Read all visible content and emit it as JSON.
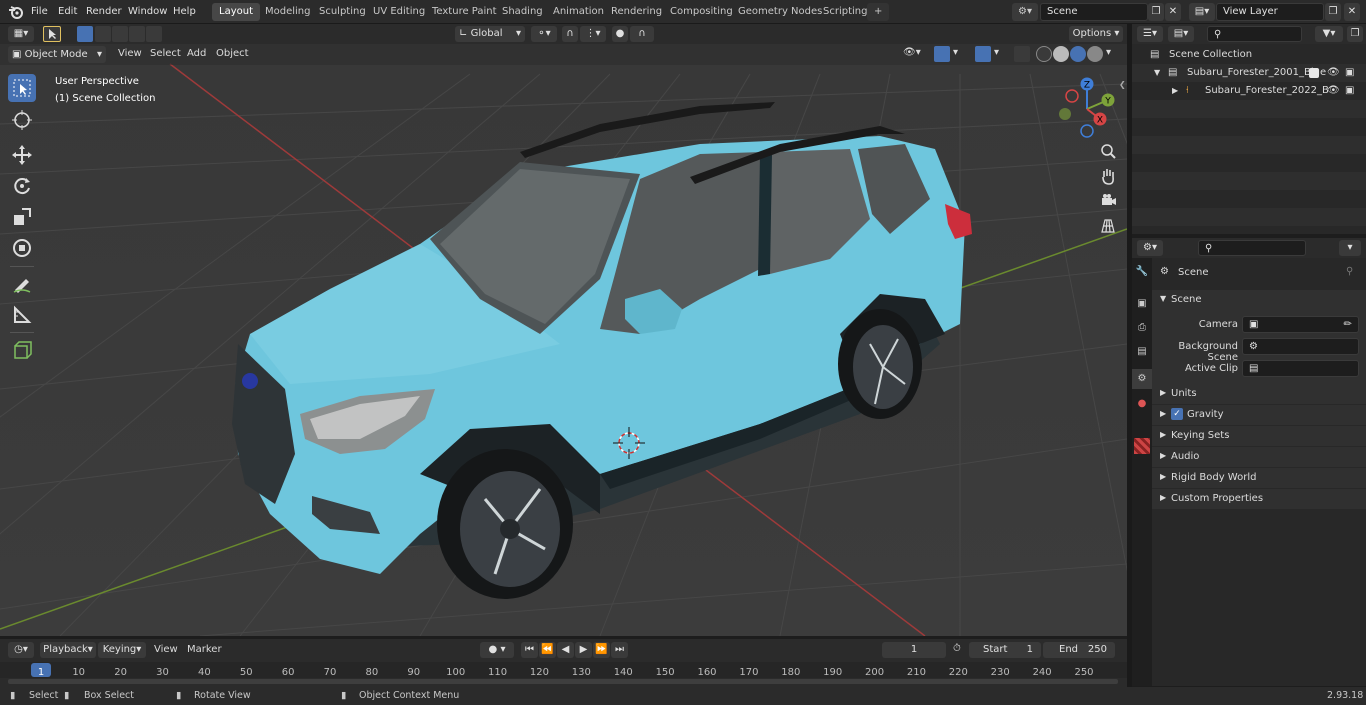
{
  "topbar": {
    "menus": [
      "File",
      "Edit",
      "Render",
      "Window",
      "Help"
    ],
    "workspaces": [
      "Layout",
      "Modeling",
      "Sculpting",
      "UV Editing",
      "Texture Paint",
      "Shading",
      "Animation",
      "Rendering",
      "Compositing",
      "Geometry Nodes",
      "Scripting"
    ],
    "active_workspace": "Layout",
    "add_tab": "+",
    "scene_name": "Scene",
    "view_layer": "View Layer"
  },
  "viewport_header": {
    "mode": "Object Mode",
    "menus": [
      "View",
      "Select",
      "Add",
      "Object"
    ],
    "transform_orientation": "Global",
    "options_label": "Options"
  },
  "viewport": {
    "overlay_line1": "User Perspective",
    "overlay_line2": "(1) Scene Collection",
    "axes": {
      "x": "X",
      "y": "Y",
      "z": "Z"
    }
  },
  "outliner": {
    "root": "Scene Collection",
    "items": [
      {
        "label": "Subaru_Forester_2001_Blue",
        "expanded": true
      },
      {
        "label": "Subaru_Forester_2022_B",
        "expanded": false
      }
    ]
  },
  "properties": {
    "context": "Scene",
    "section": "Scene",
    "fields": [
      {
        "label": "Camera",
        "value": ""
      },
      {
        "label": "Background Scene",
        "value": ""
      },
      {
        "label": "Active Clip",
        "value": ""
      }
    ],
    "panels": [
      "Units",
      "Gravity",
      "Keying Sets",
      "Audio",
      "Rigid Body World",
      "Custom Properties"
    ]
  },
  "timeline": {
    "menus": [
      "Playback",
      "Keying",
      "View",
      "Marker"
    ],
    "current_frame": "1",
    "start_label": "Start",
    "start_value": "1",
    "end_label": "End",
    "end_value": "250",
    "ticks": [
      "1",
      "10",
      "20",
      "30",
      "40",
      "50",
      "60",
      "70",
      "80",
      "90",
      "100",
      "110",
      "120",
      "130",
      "140",
      "150",
      "160",
      "170",
      "180",
      "190",
      "200",
      "210",
      "220",
      "230",
      "240",
      "250"
    ]
  },
  "statusbar": {
    "select": "Select",
    "box_select": "Box Select",
    "rotate_view": "Rotate View",
    "context_menu": "Object Context Menu",
    "version": "2.93.18"
  },
  "colors": {
    "accent": "#4772b3",
    "car_body": "#6ec6dd",
    "grid_bg": "#3a3a3a",
    "x_axis": "#d64545",
    "y_axis": "#7ea33a",
    "z_axis": "#3f7ed8"
  }
}
